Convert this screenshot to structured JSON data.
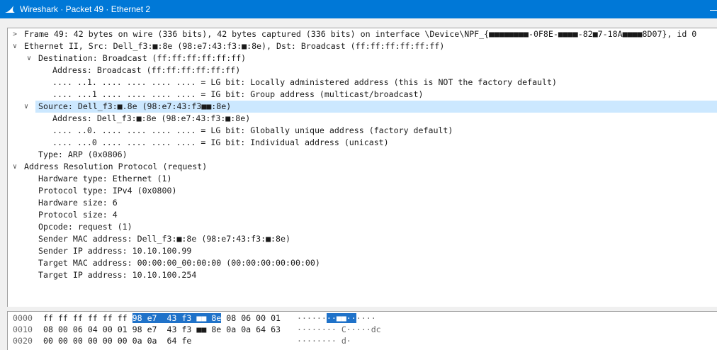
{
  "window": {
    "title": "Wireshark · Packet 49 · Ethernet 2"
  },
  "tree": [
    {
      "indent": 0,
      "toggle": "collapsed",
      "text": "Frame 49: 42 bytes on wire (336 bits), 42 bytes captured (336 bits) on interface \\Device\\NPF_{■■■■■■■■-0F8E-■■■■-82■7-18A■■■■8D07}, id 0"
    },
    {
      "indent": 0,
      "toggle": "expanded",
      "text": "Ethernet II, Src: Dell_f3:■:8e (98:e7:43:f3:■:8e), Dst: Broadcast (ff:ff:ff:ff:ff:ff)"
    },
    {
      "indent": 1,
      "toggle": "expanded",
      "text": "Destination: Broadcast (ff:ff:ff:ff:ff:ff)"
    },
    {
      "indent": 2,
      "toggle": "none",
      "text": "Address: Broadcast (ff:ff:ff:ff:ff:ff)"
    },
    {
      "indent": 2,
      "toggle": "none",
      "text": ".... ..1. .... .... .... .... = LG bit: Locally administered address (this is NOT the factory default)"
    },
    {
      "indent": 2,
      "toggle": "none",
      "text": ".... ...1 .... .... .... .... = IG bit: Group address (multicast/broadcast)"
    },
    {
      "indent": 1,
      "toggle": "expanded",
      "selected": true,
      "text": "Source: Dell_f3:■.8e (98:e7:43:f3■■:8e)"
    },
    {
      "indent": 2,
      "toggle": "none",
      "text": "Address: Dell_f3:■:8e (98:e7:43:f3:■:8e)"
    },
    {
      "indent": 2,
      "toggle": "none",
      "text": ".... ..0. .... .... .... .... = LG bit: Globally unique address (factory default)"
    },
    {
      "indent": 2,
      "toggle": "none",
      "text": ".... ...0 .... .... .... .... = IG bit: Individual address (unicast)"
    },
    {
      "indent": 1,
      "toggle": "none",
      "text": "Type: ARP (0x0806)"
    },
    {
      "indent": 0,
      "toggle": "expanded",
      "text": "Address Resolution Protocol (request)"
    },
    {
      "indent": 1,
      "toggle": "none",
      "text": "Hardware type: Ethernet (1)"
    },
    {
      "indent": 1,
      "toggle": "none",
      "text": "Protocol type: IPv4 (0x0800)"
    },
    {
      "indent": 1,
      "toggle": "none",
      "text": "Hardware size: 6"
    },
    {
      "indent": 1,
      "toggle": "none",
      "text": "Protocol size: 4"
    },
    {
      "indent": 1,
      "toggle": "none",
      "text": "Opcode: request (1)"
    },
    {
      "indent": 1,
      "toggle": "none",
      "text": "Sender MAC address: Dell_f3:■:8e (98:e7:43:f3:■:8e)"
    },
    {
      "indent": 1,
      "toggle": "none",
      "text": "Sender IP address: 10.10.100.99"
    },
    {
      "indent": 1,
      "toggle": "none",
      "text": "Target MAC address: 00:00:00_00:00:00 (00:00:00:00:00:00)"
    },
    {
      "indent": 1,
      "toggle": "none",
      "text": "Target IP address: 10.10.100.254"
    }
  ],
  "bytes": [
    {
      "offset": "0000",
      "hex_pre": "ff ff ff ff ff ff ",
      "hex_hl": "98 e7  43 f3 ■■ 8e",
      "hex_post": " 08 06 00 01",
      "ascii_pre": "······",
      "ascii_hl": "··■■··",
      "ascii_post": "····"
    },
    {
      "offset": "0010",
      "hex_pre": "08 00 06 04 00 01 98 e7  43 f3 ■■ 8e 0a 0a 64 63",
      "hex_hl": "",
      "hex_post": "",
      "ascii_pre": "········ C·····dc",
      "ascii_hl": "",
      "ascii_post": ""
    },
    {
      "offset": "0020",
      "hex_pre": "00 00 00 00 00 00 0a 0a  64 fe",
      "hex_hl": "",
      "hex_post": "",
      "ascii_pre": "········ d·",
      "ascii_hl": "",
      "ascii_post": ""
    }
  ],
  "colors": {
    "titlebar": "#0078d7",
    "selection": "#cce8ff",
    "byte_highlight": "#1f72c9"
  },
  "icons": {
    "app": "wireshark-fin-icon",
    "collapsed": "chevron-right-icon",
    "expanded": "chevron-down-icon"
  }
}
